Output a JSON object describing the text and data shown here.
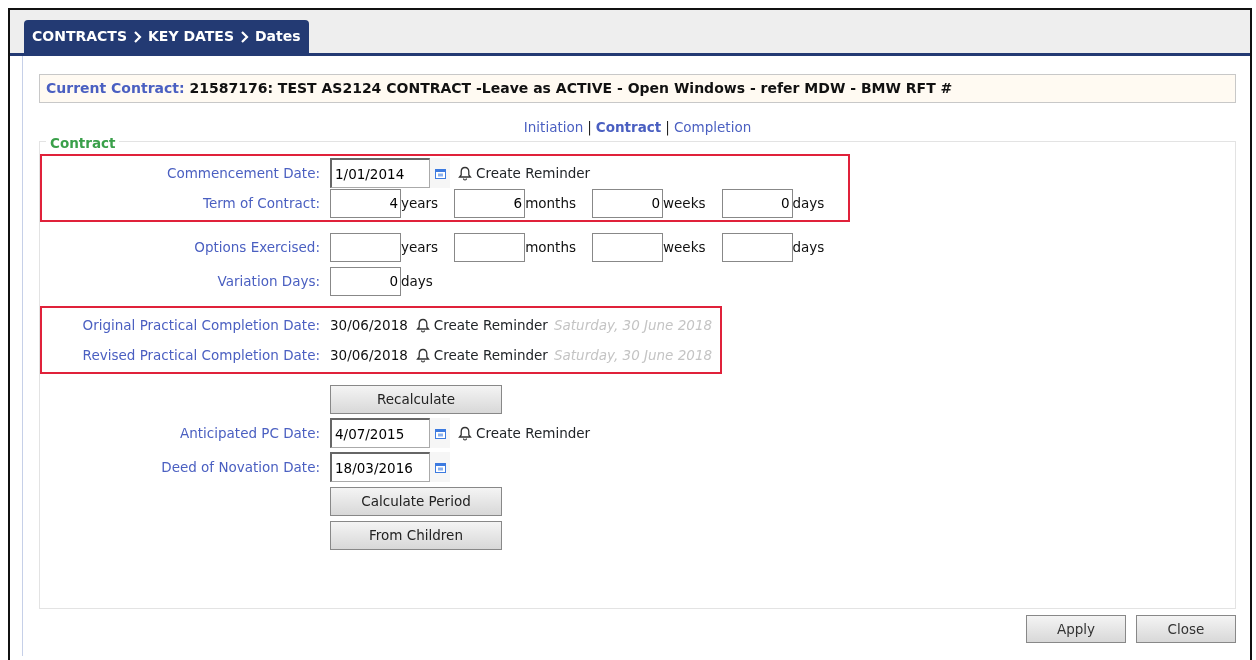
{
  "breadcrumb_tab": {
    "parts": [
      "CONTRACTS",
      "KEY DATES",
      "Dates"
    ]
  },
  "current_contract": {
    "label": "Current Contract:",
    "value": "21587176: TEST AS2124 CONTRACT -Leave as ACTIVE - Open Windows - refer MDW - BMW RFT #"
  },
  "subnav": {
    "separator": "|",
    "links": [
      {
        "label": "Initiation",
        "selected": false
      },
      {
        "label": "Contract",
        "selected": true
      },
      {
        "label": "Completion",
        "selected": false
      }
    ]
  },
  "fieldset": {
    "legend": "Contract",
    "groups": [
      {
        "highlighted": true,
        "rows": [
          {
            "kind": "date",
            "label": "Commencement Date:",
            "value": "1/01/2014",
            "reminder": "Create Reminder"
          },
          {
            "kind": "duration",
            "label": "Term of Contract:",
            "parts": [
              {
                "value": "4",
                "unit": "years"
              },
              {
                "value": "6",
                "unit": "months"
              },
              {
                "value": "0",
                "unit": "weeks"
              },
              {
                "value": "0",
                "unit": "days"
              }
            ]
          }
        ]
      },
      {
        "highlighted": false,
        "rows": [
          {
            "kind": "duration",
            "label": "Options Exercised:",
            "parts": [
              {
                "unit": "years"
              },
              {
                "unit": "months"
              },
              {
                "unit": "weeks"
              },
              {
                "unit": "days"
              }
            ]
          },
          {
            "kind": "duration",
            "label": "Variation Days:",
            "parts": [
              {
                "value": "0",
                "unit": "days"
              }
            ]
          }
        ]
      },
      {
        "highlighted": true,
        "rows": [
          {
            "kind": "completion",
            "label": "Original Practical Completion Date:",
            "date": "30/06/2018",
            "reminder": "Create Reminder",
            "weekday": "Saturday, 30 June 2018"
          },
          {
            "kind": "completion",
            "label": "Revised Practical Completion Date:",
            "date": "30/06/2018",
            "reminder": "Create Reminder",
            "weekday": "Saturday, 30 June 2018"
          }
        ]
      },
      {
        "highlighted": false,
        "rows": [
          {
            "kind": "button",
            "label": "Recalculate"
          },
          {
            "kind": "date",
            "label": "Anticipated PC Date:",
            "value": "4/07/2015",
            "reminder": "Create Reminder"
          },
          {
            "kind": "date",
            "label": "Deed of Novation Date:",
            "value": "18/03/2016"
          },
          {
            "kind": "button",
            "label": "Calculate Period"
          },
          {
            "kind": "button",
            "label": "From Children"
          }
        ]
      }
    ]
  },
  "footer_buttons": [
    "Apply",
    "Close"
  ]
}
